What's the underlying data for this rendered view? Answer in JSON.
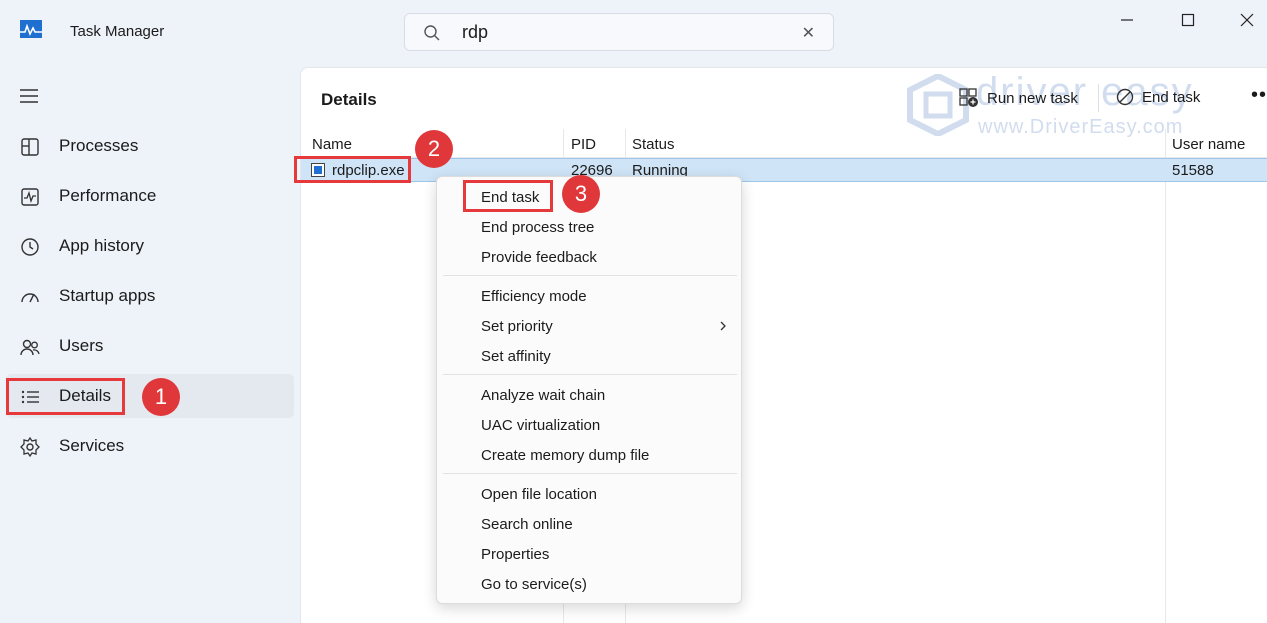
{
  "window": {
    "title": "Task Manager"
  },
  "search": {
    "value": "rdp",
    "clear_icon": "close-icon"
  },
  "sidebar": {
    "items": [
      {
        "label": "Processes",
        "icon": "processes-icon"
      },
      {
        "label": "Performance",
        "icon": "performance-icon"
      },
      {
        "label": "App history",
        "icon": "history-icon"
      },
      {
        "label": "Startup apps",
        "icon": "startup-icon"
      },
      {
        "label": "Users",
        "icon": "users-icon"
      },
      {
        "label": "Details",
        "icon": "list-icon",
        "active": true
      },
      {
        "label": "Services",
        "icon": "gear-icon"
      }
    ]
  },
  "details": {
    "title": "Details",
    "toolbar": {
      "run_new_task": "Run new task",
      "end_task": "End task",
      "more": "•••"
    },
    "columns": [
      "Name",
      "PID",
      "Status",
      "User name"
    ],
    "rows": [
      {
        "name": "rdpclip.exe",
        "pid": "22696",
        "status": "Running",
        "user": "51588"
      }
    ]
  },
  "context_menu": {
    "groups": [
      [
        "End task",
        "End process tree",
        "Provide feedback"
      ],
      [
        "Efficiency mode",
        "Set priority",
        "Set affinity"
      ],
      [
        "Analyze wait chain",
        "UAC virtualization",
        "Create memory dump file"
      ],
      [
        "Open file location",
        "Search online",
        "Properties",
        "Go to service(s)"
      ]
    ]
  },
  "annotations": {
    "badge1": "1",
    "badge2": "2",
    "badge3": "3"
  },
  "watermark": {
    "brand": "driver easy",
    "url": "www.DriverEasy.com"
  },
  "colors": {
    "accent": "#1b5fc1",
    "highlight": "#e5393b",
    "selection": "#cfe4f7"
  }
}
